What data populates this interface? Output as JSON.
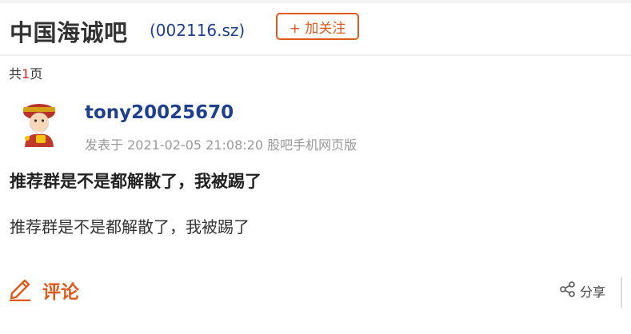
{
  "header": {
    "bar_title": "中国海诚吧",
    "stock_code": "(002116.sz)",
    "follow_label": "+ 加关注"
  },
  "pagination": {
    "prefix": "共",
    "total": "1",
    "suffix": "页"
  },
  "post": {
    "author": "tony20025670",
    "meta": "发表于 2021-02-05 21:08:20 股吧手机网页版",
    "title": "推荐群是不是都解散了，我被踢了",
    "body": "推荐群是不是都解散了，我被踢了",
    "avatar_icon": "caishen-avatar-icon"
  },
  "actions": {
    "comment_label": "评论",
    "comment_icon": "pencil-icon",
    "share_label": "分享",
    "share_icon": "share-icon"
  },
  "colors": {
    "accent": "#e05a1c",
    "link": "#1f3f8f",
    "meta": "#999999",
    "page_number": "#e02020"
  }
}
